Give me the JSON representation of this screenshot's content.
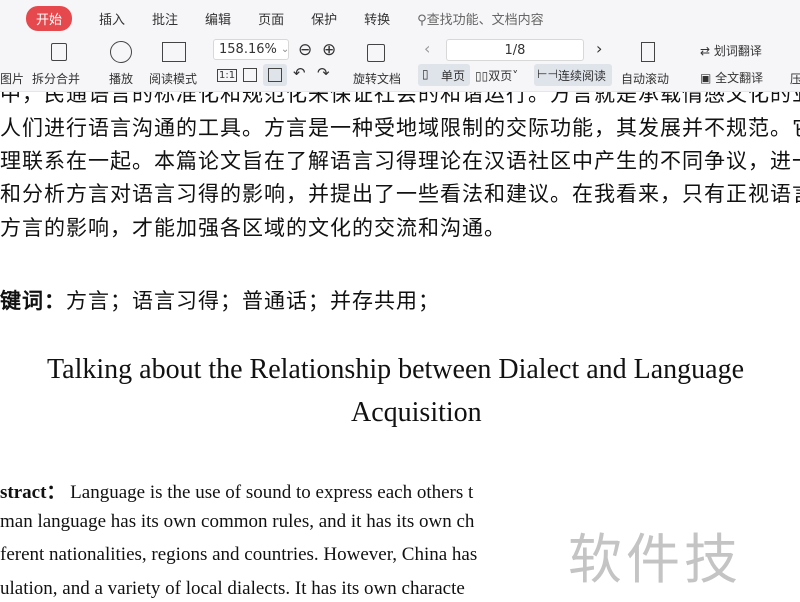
{
  "tabs": {
    "items": [
      "开始",
      "插入",
      "批注",
      "编辑",
      "页面",
      "保护",
      "转换"
    ],
    "search_placeholder": "查找功能、文档内容"
  },
  "toolbar": {
    "image": "图片",
    "split_merge": "拆分合并",
    "play": "播放",
    "read_mode": "阅读模式",
    "zoom": "158.16%",
    "rotate": "旋转文档",
    "page": "1/8",
    "single": "单页",
    "double": "双页",
    "continuous": "连续阅读",
    "auto_scroll": "自动滚动",
    "word_translate": "划词翻译",
    "full_translate": "全文翻译",
    "compress": "压"
  },
  "doc": {
    "lines": [
      "中，民通语言的标准化和规范化来保证社会的和谐运行。方言就是承载情感文化的业",
      "人们进行语言沟通的工具。方言是一种受地域限制的交际功能，其发展并不规范。它",
      "理联系在一起。本篇论文旨在了解语言习得理论在汉语社区中产生的不同争议，进一",
      "和分析方言对语言习得的影响，并提出了一些看法和建议。在我看来，只有正视语言",
      "方言的影响，才能加强各区域的文化的交流和沟通。"
    ],
    "keywords_label": "键词：",
    "keywords": "方言；语言习得；普通话；并存共用；",
    "title1": "Talking about the Relationship between Dialect and Language",
    "title2": "Acquisition",
    "abstract_label": "stract：",
    "abstract": [
      "Language is the use of sound to express each others t",
      "man language has its own common rules, and it has its own ch",
      "ferent nationalities, regions and countries. However, China has",
      "ulation, and a variety of local dialects. It has its own characte"
    ],
    "watermark": "软件技巧"
  }
}
